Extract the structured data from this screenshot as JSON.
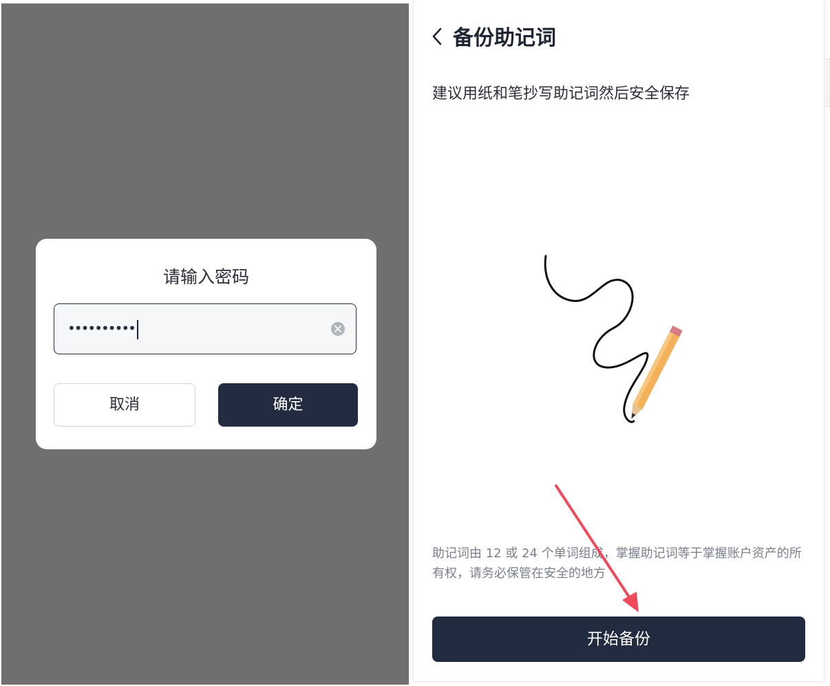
{
  "left_panel": {
    "password_dialog": {
      "title": "请输入密码",
      "password_value": "••••••••••",
      "cancel_label": "取消",
      "confirm_label": "确定"
    }
  },
  "right_panel": {
    "header": {
      "title": "备份助记词"
    },
    "subtitle": "建议用纸和笔抄写助记词然后安全保存",
    "info_text": "助记词由 12 或 24 个单词组成，掌握助记词等于掌握账户资产的所有权，请务必保管在安全的地方",
    "start_button_label": "开始备份"
  },
  "colors": {
    "primary_dark": "#232b40",
    "overlay_gray": "#6f6f6f",
    "annotation_arrow": "#f04a5d",
    "pencil": "#f4b15a"
  },
  "icons": {
    "back": "chevron-left-icon",
    "clear": "clear-circle-icon"
  }
}
